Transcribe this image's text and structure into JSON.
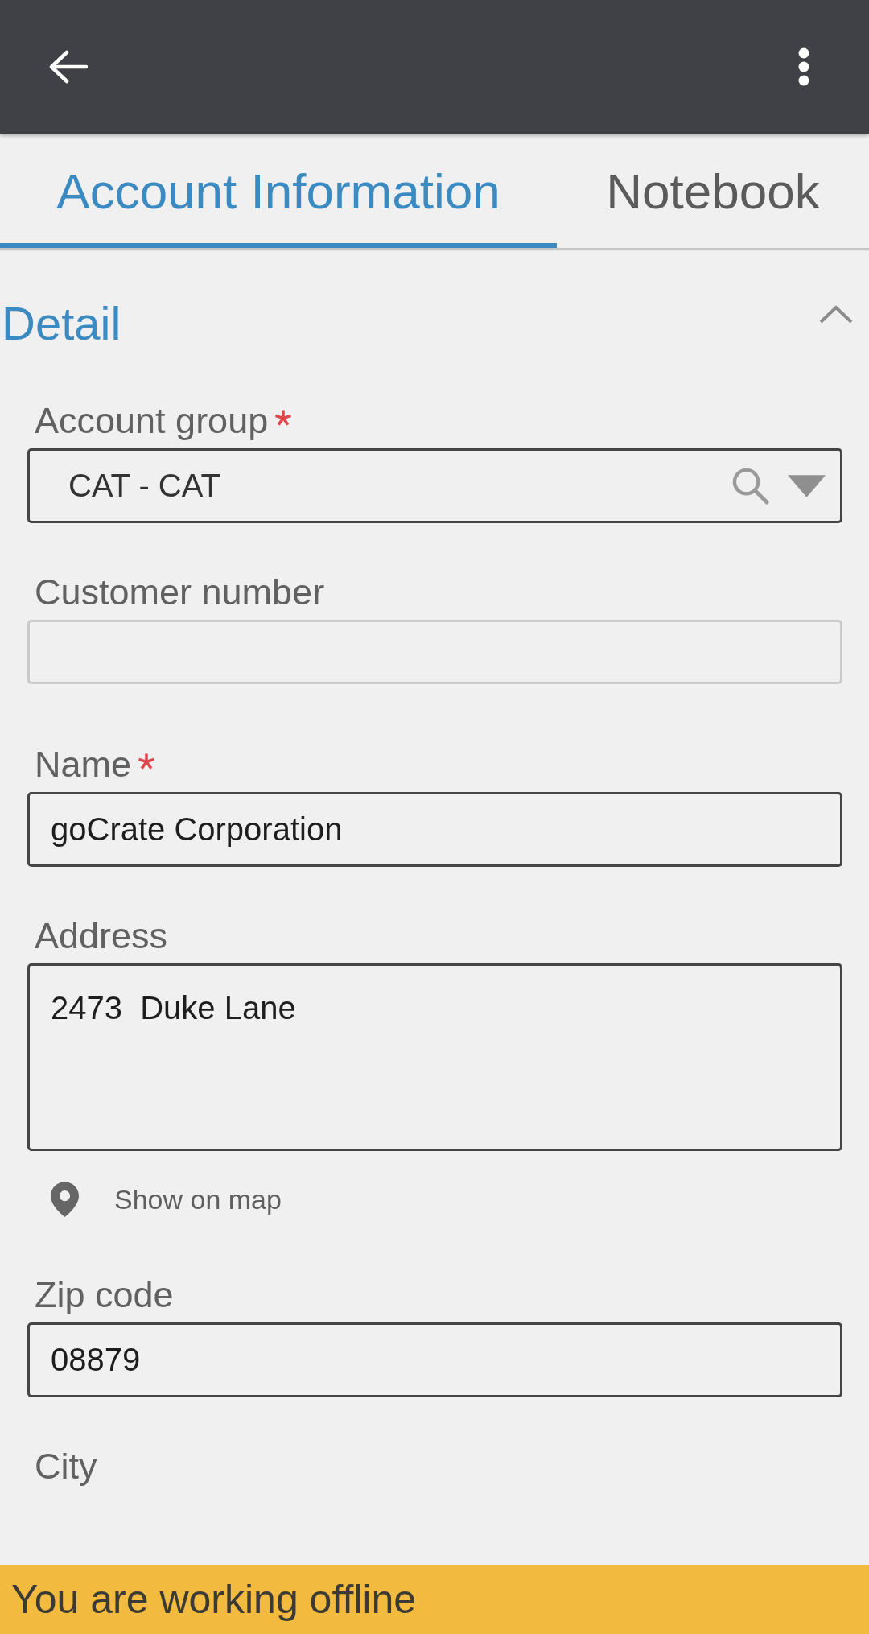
{
  "tabs": [
    {
      "label": "Account Information",
      "selected": true
    },
    {
      "label": "Notebook",
      "selected": false
    }
  ],
  "section": {
    "title": "Detail",
    "expanded": true
  },
  "fields": [
    {
      "kind": "lookup",
      "label": "Account group",
      "required": true,
      "disabled": false,
      "value": "CAT - CAT"
    },
    {
      "kind": "text",
      "label": "Customer number",
      "required": false,
      "disabled": true
    },
    {
      "kind": "text",
      "label": "Name",
      "required": true,
      "disabled": false,
      "value": "goCrate Corporation"
    },
    {
      "kind": "multiline",
      "label": "Address",
      "required": false,
      "disabled": false,
      "value": "2473  Duke Lane",
      "map_link": "Show on map"
    },
    {
      "kind": "text",
      "label": "Zip code",
      "required": false,
      "disabled": false,
      "value": "08879"
    },
    {
      "kind": "label",
      "label": "City",
      "required": false
    }
  ],
  "status_bar": {
    "text": "You are working offline"
  }
}
